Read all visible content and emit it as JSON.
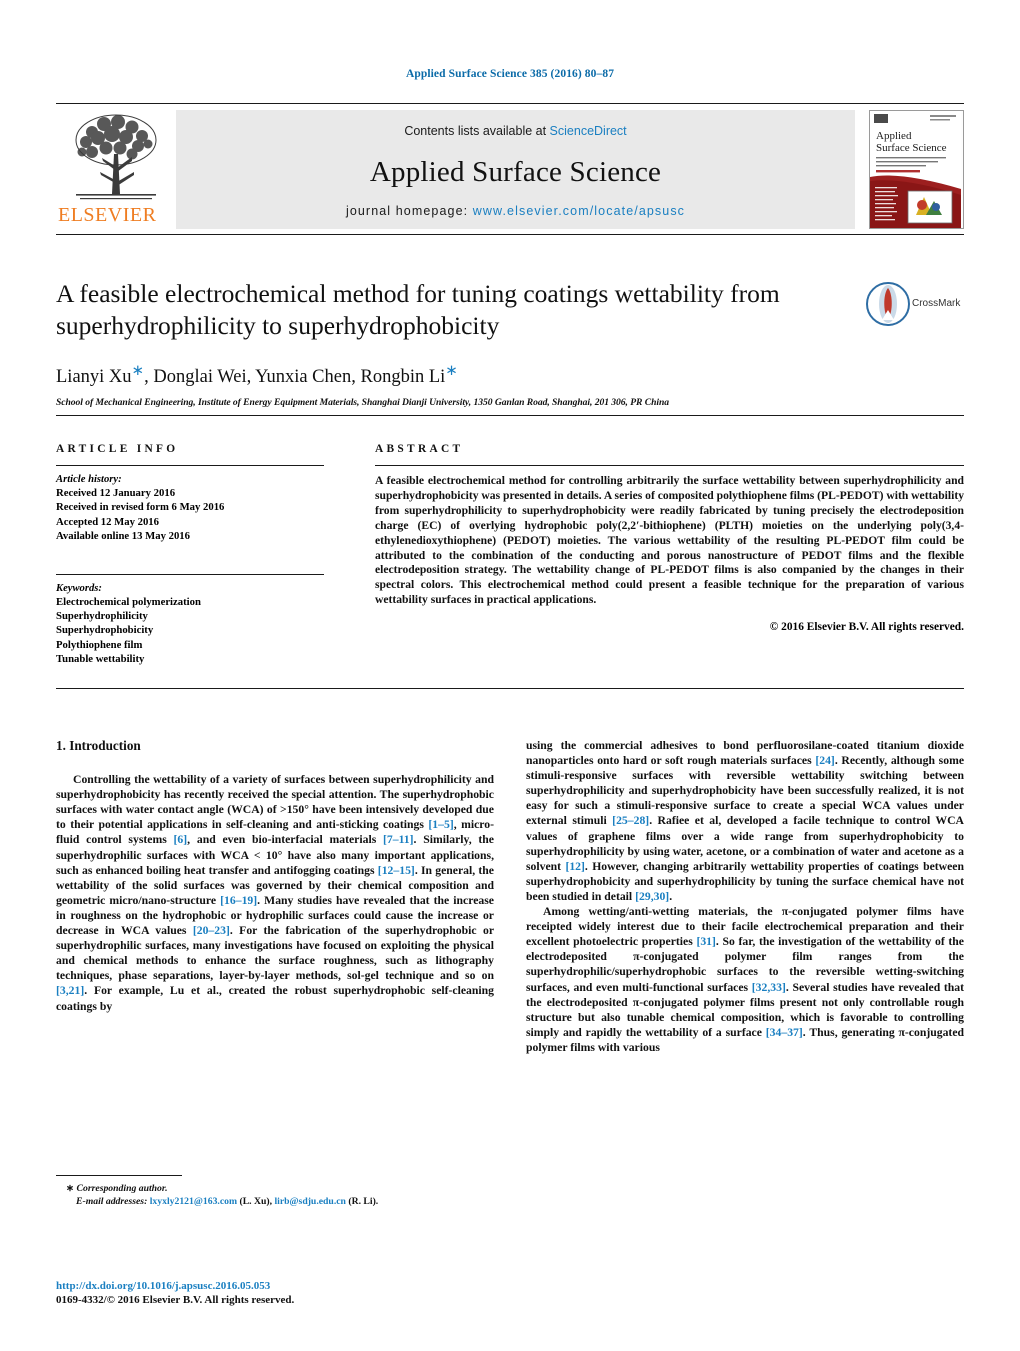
{
  "running_head": "Applied Surface Science 385 (2016) 80–87",
  "masthead": {
    "publisher_name": "ELSEVIER",
    "contents_prefix": "Contents lists available at ",
    "contents_link": "ScienceDirect",
    "journal_title": "Applied Surface Science",
    "homepage_prefix": "journal homepage: ",
    "homepage_url": "www.elsevier.com/locate/apsusc",
    "cover_title_line1": "Applied",
    "cover_title_line2": "Surface Science"
  },
  "article": {
    "title": "A feasible electrochemical method for tuning coatings wettability from superhydrophilicity to superhydrophobicity",
    "crossmark_label": "CrossMark",
    "authors": "Lianyi Xu, Donglai Wei, Yunxia Chen, Rongbin Li",
    "authors_parts": {
      "a1": "Lianyi Xu",
      "a2": ", Donglai Wei, Yunxia Chen, Rongbin Li",
      "star": "∗"
    },
    "affiliation": "School of Mechanical Engineering, Institute of Energy Equipment Materials, Shanghai Dianji University, 1350 Ganlan Road, Shanghai, 201 306, PR China"
  },
  "info": {
    "heading": "ARTICLE INFO",
    "history_label": "Article history:",
    "history": [
      "Received 12 January 2016",
      "Received in revised form 6 May 2016",
      "Accepted 12 May 2016",
      "Available online 13 May 2016"
    ],
    "keywords_label": "Keywords:",
    "keywords": [
      "Electrochemical polymerization",
      "Superhydrophilicity",
      "Superhydrophobicity",
      "Polythiophene film",
      "Tunable wettability"
    ]
  },
  "abstract": {
    "heading": "ABSTRACT",
    "text": "A feasible electrochemical method for controlling arbitrarily the surface wettability between superhydrophilicity and superhydrophobicity was presented in details. A series of composited polythiophene films (PL-PEDOT) with wettability from superhydrophilicity to superhydrophobicity were readily fabricated by tuning precisely the electrodeposition charge (EC) of overlying hydrophobic poly(2,2′-bithiophene) (PLTH) moieties on the underlying poly(3,4-ethylenedioxythiophene) (PEDOT) moieties. The various wettability of the resulting PL-PEDOT film could be attributed to the combination of the conducting and porous nanostructure of PEDOT films and the flexible electrodeposition strategy. The wettability change of PL-PEDOT films is also companied by the changes in their spectral colors. This electrochemical method could present a feasible technique for the preparation of various wettability surfaces in practical applications.",
    "copyright": "© 2016 Elsevier B.V. All rights reserved."
  },
  "introduction": {
    "section_title": "1. Introduction",
    "left_para_1_a": "Controlling the wettability of a variety of surfaces between superhydrophilicity and superhydrophobicity has recently received the special attention. The superhydrophobic surfaces with water contact angle (WCA) of >150° have been intensively developed due to their potential applications in self-cleaning and anti-sticking coatings ",
    "cite_1_5": "[1–5]",
    "left_para_1_b": ", micro-fluid control systems ",
    "cite_6": "[6]",
    "left_para_1_c": ", and even bio-interfacial materials ",
    "cite_7_11": "[7–11]",
    "left_para_1_d": ". Similarly, the superhydrophilic surfaces with WCA < 10° have also many important applications, such as enhanced boiling heat transfer and antifogging coatings ",
    "cite_12_15": "[12–15]",
    "left_para_1_e": ". In general, the wettability of the solid surfaces was governed by their chemical composition and geometric micro/nano-structure ",
    "cite_16_19": "[16–19]",
    "left_para_1_f": ". Many studies have revealed that the increase in roughness on the hydrophobic or hydrophilic surfaces could cause the increase or decrease in WCA values ",
    "cite_20_23": "[20–23]",
    "left_para_1_g": ". For the fabrication of the superhydrophobic or superhydrophilic surfaces, many investigations have focused on exploiting the physical and chemical methods to enhance the surface roughness, such as lithography techniques, phase separations, layer-by-layer methods, sol-gel technique and so on ",
    "cite_3_21": "[3,21]",
    "left_para_1_h": ". For example, Lu et al., created the robust superhydrophobic self-cleaning coatings by",
    "right_para_1_a": "using the commercial adhesives to bond perfluorosilane-coated titanium dioxide nanoparticles onto hard or soft rough materials surfaces ",
    "cite_24": "[24]",
    "right_para_1_b": ". Recently, although some stimuli-responsive surfaces with reversible wettability switching between superhydrophilicity and superhydrophobicity have been successfully realized, it is not easy for such a stimuli-responsive surface to create a special WCA values under external stimuli ",
    "cite_25_28": "[25–28]",
    "right_para_1_c": ". Rafiee et al, developed a facile technique to control WCA values of graphene films over a wide range from superhydrophobicity to superhydrophilicity by using water, acetone, or a combination of water and acetone as a solvent ",
    "cite_12": "[12]",
    "right_para_1_d": ". However, changing arbitrarily wettability properties of coatings between superhydrophobicity and superhydrophilicity by tuning the surface chemical have not been studied in detail ",
    "cite_29_30": "[29,30]",
    "right_para_1_e": ".",
    "right_para_2_a": "Among wetting/anti-wetting materials, the π-conjugated polymer films have receipted widely interest due to their facile electrochemical preparation and their excellent photoelectric properties ",
    "cite_31": "[31]",
    "right_para_2_b": ". So far, the investigation of the wettability of the electrodeposited π-conjugated polymer film ranges from the superhydrophilic/superhydrophobic surfaces to the reversible wetting-switching surfaces, and even multi-functional surfaces ",
    "cite_32_33": "[32,33]",
    "right_para_2_c": ". Several studies have revealed that the electrodeposited π-conjugated polymer films present not only controllable rough structure but also tunable chemical composition, which is favorable to controlling simply and rapidly the wettability of a surface ",
    "cite_34_37": "[34–37]",
    "right_para_2_d": ". Thus, generating π-conjugated polymer films with various"
  },
  "footnote": {
    "corresponding_star": "∗",
    "corresponding_label": "Corresponding author.",
    "email_label": "E-mail addresses:",
    "email_1": "lxyxly2121@163.com",
    "email_1_owner": " (L. Xu), ",
    "email_2": "lirb@sdju.edu.cn",
    "email_2_owner": " (R. Li)."
  },
  "doi": {
    "url": "http://dx.doi.org/10.1016/j.apsusc.2016.05.053",
    "issn_line": "0169-4332/© 2016 Elsevier B.V. All rights reserved."
  },
  "colors": {
    "link": "#1a7fc1",
    "running_head": "#0b6ba8",
    "elsevier_orange": "#ef7d22",
    "masthead_bg": "#e9e9e9"
  }
}
